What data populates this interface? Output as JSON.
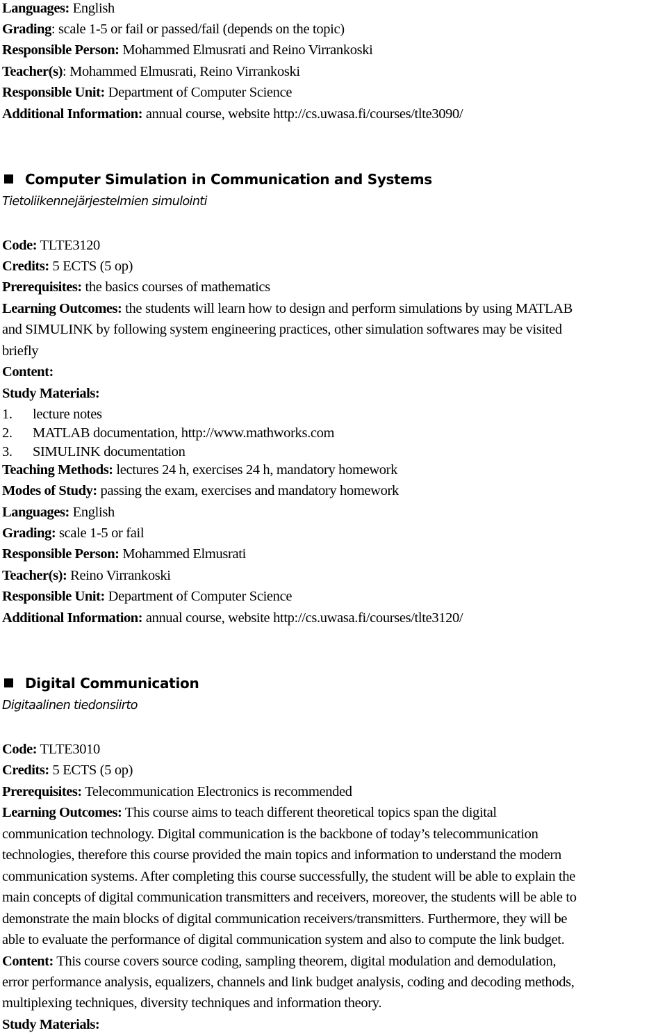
{
  "previous_course": {
    "fields": [
      {
        "label": "Languages:",
        "value": " English"
      },
      {
        "label": "Grading",
        "value": ": scale 1-5 or fail or passed/fail (depends on the topic)"
      },
      {
        "label": "Responsible Person:",
        "value": " Mohammed Elmusrati and Reino Virrankoski"
      },
      {
        "label": "Teacher(s)",
        "value": ": Mohammed Elmusrati, Reino Virrankoski"
      },
      {
        "label": "Responsible Unit:",
        "value": " Department of Computer Science"
      },
      {
        "label": "Additional Information:",
        "value": " annual course, website http://cs.uwasa.fi/courses/tlte3090/"
      }
    ]
  },
  "course_1": {
    "title": "Computer Simulation in Communication and Systems",
    "subtitle": "Tietoliikennejärjestelmien simulointi",
    "code": {
      "label": "Code:",
      "value": " TLTE3120"
    },
    "credits": {
      "label": "Credits:",
      "value": " 5 ECTS (5 op)"
    },
    "prerequisites": {
      "label": "Prerequisites:",
      "value": " the basics courses of mathematics"
    },
    "learning_outcomes": {
      "label": "Learning Outcomes:",
      "lines": [
        " the students will learn how to design and perform simulations by using MATLAB",
        "and SIMULINK by following system engineering practices, other simulation softwares may be visited",
        "briefly"
      ]
    },
    "content": {
      "label": "Content:"
    },
    "study_materials": {
      "label": "Study Materials:",
      "items": [
        {
          "num": "1.",
          "text": "lecture notes"
        },
        {
          "num": "2.",
          "text": "MATLAB documentation, http://www.mathworks.com"
        },
        {
          "num": "3.",
          "text": "SIMULINK documentation"
        }
      ]
    },
    "teaching_methods": {
      "label": "Teaching Methods:",
      "value": " lectures 24 h, exercises 24 h, mandatory homework"
    },
    "modes_of_study": {
      "label": "Modes of Study:",
      "value": " passing the exam, exercises and mandatory homework"
    },
    "languages": {
      "label": "Languages:",
      "value": " English"
    },
    "grading": {
      "label": "Grading:",
      "value": " scale 1-5 or fail"
    },
    "responsible_person": {
      "label": "Responsible Person:",
      "value": " Mohammed Elmusrati"
    },
    "teachers": {
      "label": "Teacher(s):",
      "value": " Reino Virrankoski"
    },
    "responsible_unit": {
      "label": "Responsible Unit:",
      "value": " Department of Computer Science"
    },
    "additional_info": {
      "label": "Additional Information:",
      "value": " annual course,  website http://cs.uwasa.fi/courses/tlte3120/"
    }
  },
  "course_2": {
    "title": "Digital Communication",
    "subtitle": "Digitaalinen tiedonsiirto",
    "code": {
      "label": "Code:",
      "value": " TLTE3010"
    },
    "credits": {
      "label": "Credits:",
      "value": " 5 ECTS (5 op)"
    },
    "prerequisites": {
      "label": "Prerequisites:",
      "value": " Telecommunication Electronics is recommended"
    },
    "learning_outcomes": {
      "label": "Learning Outcomes:",
      "lines": [
        " This course aims to teach different theoretical topics span the digital",
        "communication technology. Digital communication is the backbone of today’s telecommunication",
        "technologies, therefore this course provided the main topics and information to understand the modern",
        "communication systems.  After completing this course successfully, the student will be able to explain the",
        "main concepts of digital communication transmitters and receivers, moreover, the students will be able to",
        "demonstrate the main blocks of digital communication receivers/transmitters. Furthermore, they will be",
        "able to evaluate the performance of digital communication system and also to compute the link budget."
      ]
    },
    "content": {
      "label": "Content:",
      "lines": [
        " This course covers source coding, sampling theorem, digital modulation and demodulation,",
        "error performance analysis, equalizers, channels and link budget analysis, coding and decoding methods,",
        "multiplexing techniques, diversity techniques and information theory."
      ]
    },
    "study_materials": {
      "label": "Study Materials:"
    }
  }
}
